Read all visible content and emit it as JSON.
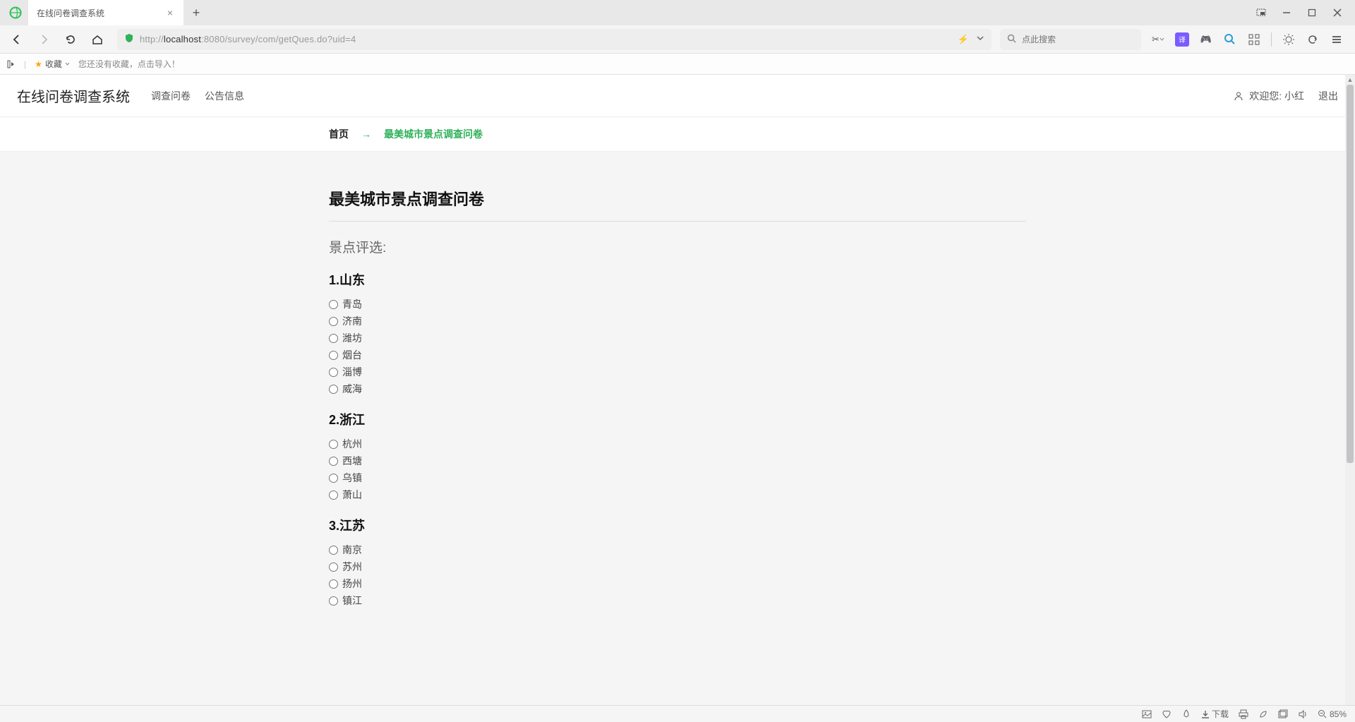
{
  "browser": {
    "tab_title": "在线问卷调查系统",
    "url_prefix": "http://",
    "url_host": "localhost",
    "url_port_path": ":8080/survey/com/getQues.do?uid=4",
    "search_placeholder": "点此搜索"
  },
  "bookmarks": {
    "fav_label": "收藏",
    "hint": "您还没有收藏，点击导入！"
  },
  "header": {
    "site_title": "在线问卷调查系统",
    "nav": [
      {
        "label": "调查问卷"
      },
      {
        "label": "公告信息"
      }
    ],
    "welcome_prefix": "欢迎您: ",
    "username": "小红",
    "logout_label": "退出"
  },
  "breadcrumb": {
    "home": "首页",
    "current": "最美城市景点调查问卷"
  },
  "survey": {
    "title": "最美城市景点调查问卷",
    "section_label": "景点评选:",
    "questions": [
      {
        "number": "1.",
        "text": "山东",
        "options": [
          "青岛",
          "济南",
          "潍坊",
          "烟台",
          "淄博",
          "威海"
        ]
      },
      {
        "number": "2.",
        "text": "浙江",
        "options": [
          "杭州",
          "西塘",
          "乌镇",
          "萧山"
        ]
      },
      {
        "number": "3.",
        "text": "江苏",
        "options": [
          "南京",
          "苏州",
          "扬州",
          "镇江"
        ]
      }
    ]
  },
  "statusbar": {
    "download_label": "下载",
    "zoom_label": "85%"
  }
}
